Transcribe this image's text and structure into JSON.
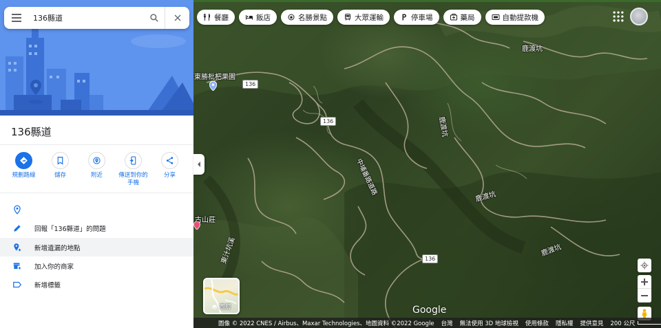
{
  "search": {
    "value": "136縣道",
    "placeholder": ""
  },
  "panel": {
    "title": "136縣道",
    "actions": [
      {
        "label": "規劃路線",
        "icon": "directions-icon"
      },
      {
        "label": "儲存",
        "icon": "bookmark-icon"
      },
      {
        "label": "附近",
        "icon": "nearby-icon"
      },
      {
        "label": "傳送到你的手機",
        "icon": "send-to-phone-icon"
      },
      {
        "label": "分享",
        "icon": "share-icon"
      }
    ],
    "info": [
      {
        "text": "",
        "icon": "location-pin-icon"
      },
      {
        "text": "回報「136縣道」的問題",
        "icon": "pencil-icon"
      },
      {
        "text": "新增遺漏的地點",
        "icon": "add-place-icon"
      },
      {
        "text": "加入你的商家",
        "icon": "add-business-icon"
      },
      {
        "text": "新增標籤",
        "icon": "label-icon"
      }
    ]
  },
  "chips": [
    {
      "label": "餐廳",
      "icon": "restaurant-icon"
    },
    {
      "label": "飯店",
      "icon": "hotel-icon"
    },
    {
      "label": "名勝景點",
      "icon": "attraction-icon"
    },
    {
      "label": "大眾運輸",
      "icon": "transit-icon"
    },
    {
      "label": "停車場",
      "icon": "parking-icon"
    },
    {
      "label": "藥局",
      "icon": "pharmacy-icon"
    },
    {
      "label": "自動提款機",
      "icon": "atm-icon"
    }
  ],
  "map": {
    "labels": {
      "orchard": "東勝枇杷果園",
      "mountain_villa": "古山莊",
      "road_name": "中埔番路道路",
      "luduken_1": "鹿渡坑",
      "luduken_2": "鹿渡坑",
      "luduken_3": "鹿渡坑",
      "luduken_4": "鹿渡坑",
      "dongzhiken": "東汁坑溪"
    },
    "road_number": "136"
  },
  "layers": {
    "label": "圖層"
  },
  "google_logo": "Google",
  "footer": {
    "imagery": "圖像 © 2022 CNES / Airbus、Maxar Technologies、地圖資料 ©2022 Google",
    "region": "台灣",
    "no_3d": "無法使用 3D 地球檢視",
    "terms": "使用條款",
    "privacy": "隱私權",
    "feedback": "提供意見",
    "scale": "200 公尺"
  },
  "colors": {
    "accent": "#1a73e8",
    "hero_bg": "#5e93ee"
  }
}
